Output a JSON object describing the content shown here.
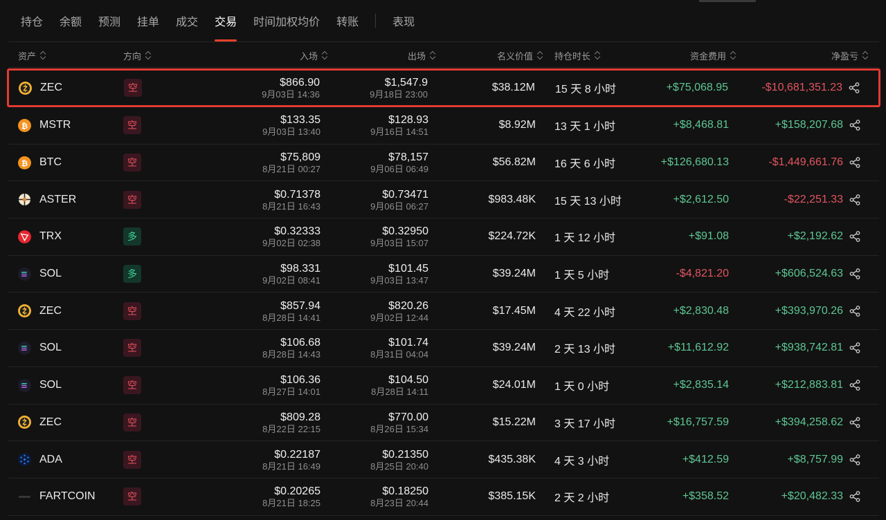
{
  "tabs": [
    {
      "label": "持仓"
    },
    {
      "label": "余额"
    },
    {
      "label": "预测"
    },
    {
      "label": "挂单"
    },
    {
      "label": "成交"
    },
    {
      "label": "交易",
      "active": true
    },
    {
      "label": "时间加权均价"
    },
    {
      "label": "转账"
    },
    {
      "label": "表现"
    }
  ],
  "columns": {
    "asset": "资产",
    "direction": "方向",
    "entry": "入场",
    "exit": "出场",
    "notional": "名义价值",
    "duration": "持仓时长",
    "funding": "资金费用",
    "pnl": "净盈亏"
  },
  "colors": {
    "accent": "#e8412c",
    "highlight_border": "#e23b33",
    "positive": "#5ec794",
    "negative": "#e25560"
  },
  "rows": [
    {
      "asset": "ZEC",
      "icon": "zec-icon",
      "dir": "空",
      "entry": "$866.90",
      "entry_time": "9月03日 14:36",
      "exit": "$1,547.9",
      "exit_time": "9月18日 23:00",
      "notional": "$38.12M",
      "duration": "15 天 8 小时",
      "funding": "+$75,068.95",
      "pnl": "-$10,681,351.23",
      "highlighted": true
    },
    {
      "asset": "MSTR",
      "icon": "bitcoin-icon",
      "dir": "空",
      "entry": "$133.35",
      "entry_time": "9月03日 13:40",
      "exit": "$128.93",
      "exit_time": "9月16日 14:51",
      "notional": "$8.92M",
      "duration": "13 天 1 小时",
      "funding": "+$8,468.81",
      "pnl": "+$158,207.68"
    },
    {
      "asset": "BTC",
      "icon": "bitcoin-icon",
      "dir": "空",
      "entry": "$75,809",
      "entry_time": "8月21日 00:27",
      "exit": "$78,157",
      "exit_time": "9月06日 06:49",
      "notional": "$56.82M",
      "duration": "16 天 6 小时",
      "funding": "+$126,680.13",
      "pnl": "-$1,449,661.76"
    },
    {
      "asset": "ASTER",
      "icon": "aster-icon",
      "dir": "空",
      "entry": "$0.71378",
      "entry_time": "8月21日 16:43",
      "exit": "$0.73471",
      "exit_time": "9月06日 06:27",
      "notional": "$983.48K",
      "duration": "15 天 13 小时",
      "funding": "+$2,612.50",
      "pnl": "-$22,251.33"
    },
    {
      "asset": "TRX",
      "icon": "tron-icon",
      "dir": "多",
      "entry": "$0.32333",
      "entry_time": "9月02日 02:38",
      "exit": "$0.32950",
      "exit_time": "9月03日 15:07",
      "notional": "$224.72K",
      "duration": "1 天 12 小时",
      "funding": "+$91.08",
      "pnl": "+$2,192.62"
    },
    {
      "asset": "SOL",
      "icon": "solana-icon",
      "dir": "多",
      "entry": "$98.331",
      "entry_time": "9月02日 08:41",
      "exit": "$101.45",
      "exit_time": "9月03日 13:47",
      "notional": "$39.24M",
      "duration": "1 天 5 小时",
      "funding": "-$4,821.20",
      "pnl": "+$606,524.63"
    },
    {
      "asset": "ZEC",
      "icon": "zec-icon",
      "dir": "空",
      "entry": "$857.94",
      "entry_time": "8月28日 14:41",
      "exit": "$820.26",
      "exit_time": "9月02日 12:44",
      "notional": "$17.45M",
      "duration": "4 天 22 小时",
      "funding": "+$2,830.48",
      "pnl": "+$393,970.26"
    },
    {
      "asset": "SOL",
      "icon": "solana-icon",
      "dir": "空",
      "entry": "$106.68",
      "entry_time": "8月28日 14:43",
      "exit": "$101.74",
      "exit_time": "8月31日 04:04",
      "notional": "$39.24M",
      "duration": "2 天 13 小时",
      "funding": "+$11,612.92",
      "pnl": "+$938,742.81"
    },
    {
      "asset": "SOL",
      "icon": "solana-icon",
      "dir": "空",
      "entry": "$106.36",
      "entry_time": "8月27日 14:01",
      "exit": "$104.50",
      "exit_time": "8月28日 14:11",
      "notional": "$24.01M",
      "duration": "1 天 0 小时",
      "funding": "+$2,835.14",
      "pnl": "+$212,883.81"
    },
    {
      "asset": "ZEC",
      "icon": "zec-icon",
      "dir": "空",
      "entry": "$809.28",
      "entry_time": "8月22日 22:15",
      "exit": "$770.00",
      "exit_time": "8月26日 15:34",
      "notional": "$15.22M",
      "duration": "3 天 17 小时",
      "funding": "+$16,757.59",
      "pnl": "+$394,258.62"
    },
    {
      "asset": "ADA",
      "icon": "cardano-icon",
      "dir": "空",
      "entry": "$0.22187",
      "entry_time": "8月21日 16:49",
      "exit": "$0.21350",
      "exit_time": "8月25日 20:40",
      "notional": "$435.38K",
      "duration": "4 天 3 小时",
      "funding": "+$412.59",
      "pnl": "+$8,757.99"
    },
    {
      "asset": "FARTCOIN",
      "icon": "fartcoin-icon",
      "dir": "空",
      "entry": "$0.20265",
      "entry_time": "8月21日 18:25",
      "exit": "$0.18250",
      "exit_time": "8月23日 20:44",
      "notional": "$385.15K",
      "duration": "2 天 2 小时",
      "funding": "+$358.52",
      "pnl": "+$20,482.33"
    }
  ]
}
